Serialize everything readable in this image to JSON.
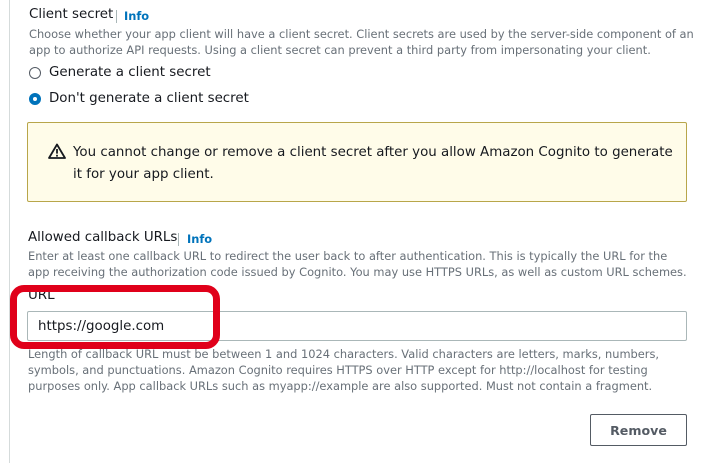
{
  "client_secret": {
    "title": "Client secret",
    "info": "Info",
    "description": "Choose whether your app client will have a client secret. Client secrets are used by the server-side component of an app to authorize API requests. Using a client secret can prevent a third party from impersonating your client.",
    "options": [
      {
        "label": "Generate a client secret",
        "selected": false
      },
      {
        "label": "Don't generate a client secret",
        "selected": true
      }
    ],
    "warning": "You cannot change or remove a client secret after you allow Amazon Cognito to generate it for your app client."
  },
  "callback_urls": {
    "title": "Allowed callback URLs",
    "info": "Info",
    "description": "Enter at least one callback URL to redirect the user back to after authentication. This is typically the URL for the app receiving the authorization code issued by Cognito. You may use HTTPS URLs, as well as custom URL schemes.",
    "url_label": "URL",
    "url_value": "https://google.com",
    "constraint": "Length of callback URL must be between 1 and 1024 characters. Valid characters are letters, marks, numbers, symbols, and punctuations. Amazon Cognito requires HTTPS over HTTP except for http://localhost for testing purposes only. App callback URLs such as myapp://example are also supported. Must not contain a fragment.",
    "remove_label": "Remove"
  },
  "colors": {
    "link": "#0073bb",
    "warning_bg": "#fffce9",
    "warning_border": "#b8a64a",
    "highlight": "#e0001a"
  },
  "icons": [
    "warning-triangle-icon"
  ]
}
